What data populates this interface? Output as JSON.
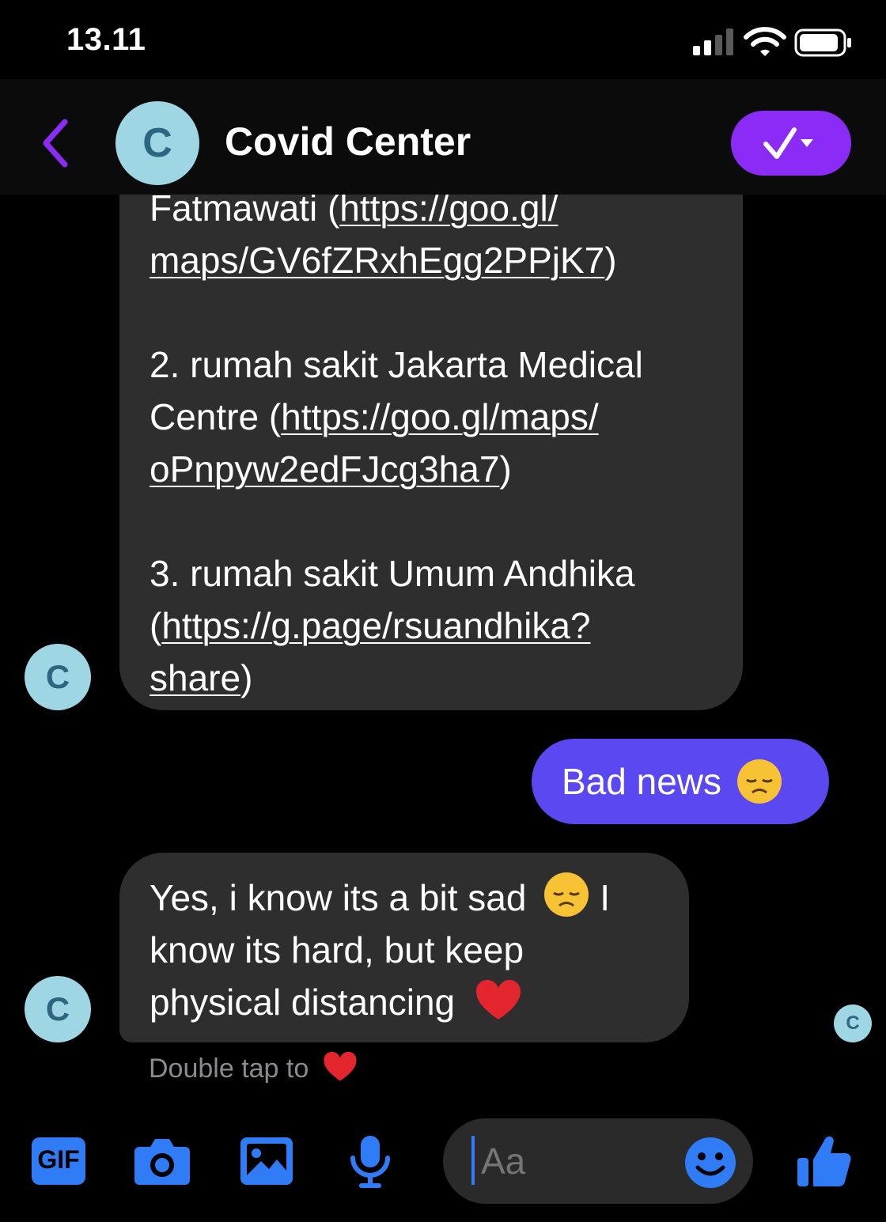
{
  "status_bar": {
    "time": "13.11"
  },
  "header": {
    "avatar_letter": "C",
    "title": "Covid Center"
  },
  "conversation": {
    "message_1": {
      "line1_prefix": "Fatmawati (",
      "line1_link": "https://goo.gl/",
      "line2_link": "maps/GV6fZRxhEgg2PPjK7",
      "line2_suffix": ")",
      "item2_text": "2. rumah sakit Jakarta Medical",
      "item2_line2_prefix": "Centre (",
      "item2_link_a": "https://goo.gl/maps/",
      "item2_link_b": "oPnpyw2edFJcg3ha7",
      "item2_suffix": ")",
      "item3_text": "3. rumah sakit Umum Andhika",
      "item3_prefix": "(",
      "item3_link_a": "https://g.page/rsuandhika?",
      "item3_link_b": "share",
      "item3_suffix": ")"
    },
    "avatar_letter": "C",
    "outgoing": {
      "text": "Bad news"
    },
    "message_2": {
      "line1": "Yes, i know its a bit sad",
      "line1_after": "I",
      "line2": "know its hard, but keep",
      "line3": "physical distancing"
    },
    "hint": "Double tap to"
  },
  "composer": {
    "gif_label": "GIF",
    "placeholder": "Aa"
  },
  "colors": {
    "accent_purple": "#8a2cf6",
    "outgoing_bubble": "#5a48f0",
    "incoming_bubble": "#2e2e2e",
    "toolbar_blue": "#2f7cf6",
    "avatar_bg": "#9fd6e4"
  }
}
